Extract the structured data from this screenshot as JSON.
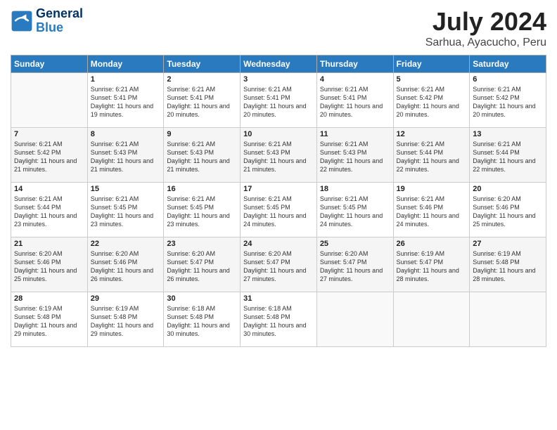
{
  "header": {
    "logo_line1": "General",
    "logo_line2": "Blue",
    "month_title": "July 2024",
    "location": "Sarhua, Ayacucho, Peru"
  },
  "days_of_week": [
    "Sunday",
    "Monday",
    "Tuesday",
    "Wednesday",
    "Thursday",
    "Friday",
    "Saturday"
  ],
  "weeks": [
    [
      {
        "day": "",
        "sunrise": "",
        "sunset": "",
        "daylight": ""
      },
      {
        "day": "1",
        "sunrise": "6:21 AM",
        "sunset": "5:41 PM",
        "daylight": "11 hours and 19 minutes."
      },
      {
        "day": "2",
        "sunrise": "6:21 AM",
        "sunset": "5:41 PM",
        "daylight": "11 hours and 20 minutes."
      },
      {
        "day": "3",
        "sunrise": "6:21 AM",
        "sunset": "5:41 PM",
        "daylight": "11 hours and 20 minutes."
      },
      {
        "day": "4",
        "sunrise": "6:21 AM",
        "sunset": "5:41 PM",
        "daylight": "11 hours and 20 minutes."
      },
      {
        "day": "5",
        "sunrise": "6:21 AM",
        "sunset": "5:42 PM",
        "daylight": "11 hours and 20 minutes."
      },
      {
        "day": "6",
        "sunrise": "6:21 AM",
        "sunset": "5:42 PM",
        "daylight": "11 hours and 20 minutes."
      }
    ],
    [
      {
        "day": "7",
        "sunrise": "6:21 AM",
        "sunset": "5:42 PM",
        "daylight": "11 hours and 21 minutes."
      },
      {
        "day": "8",
        "sunrise": "6:21 AM",
        "sunset": "5:43 PM",
        "daylight": "11 hours and 21 minutes."
      },
      {
        "day": "9",
        "sunrise": "6:21 AM",
        "sunset": "5:43 PM",
        "daylight": "11 hours and 21 minutes."
      },
      {
        "day": "10",
        "sunrise": "6:21 AM",
        "sunset": "5:43 PM",
        "daylight": "11 hours and 21 minutes."
      },
      {
        "day": "11",
        "sunrise": "6:21 AM",
        "sunset": "5:43 PM",
        "daylight": "11 hours and 22 minutes."
      },
      {
        "day": "12",
        "sunrise": "6:21 AM",
        "sunset": "5:44 PM",
        "daylight": "11 hours and 22 minutes."
      },
      {
        "day": "13",
        "sunrise": "6:21 AM",
        "sunset": "5:44 PM",
        "daylight": "11 hours and 22 minutes."
      }
    ],
    [
      {
        "day": "14",
        "sunrise": "6:21 AM",
        "sunset": "5:44 PM",
        "daylight": "11 hours and 23 minutes."
      },
      {
        "day": "15",
        "sunrise": "6:21 AM",
        "sunset": "5:45 PM",
        "daylight": "11 hours and 23 minutes."
      },
      {
        "day": "16",
        "sunrise": "6:21 AM",
        "sunset": "5:45 PM",
        "daylight": "11 hours and 23 minutes."
      },
      {
        "day": "17",
        "sunrise": "6:21 AM",
        "sunset": "5:45 PM",
        "daylight": "11 hours and 24 minutes."
      },
      {
        "day": "18",
        "sunrise": "6:21 AM",
        "sunset": "5:45 PM",
        "daylight": "11 hours and 24 minutes."
      },
      {
        "day": "19",
        "sunrise": "6:21 AM",
        "sunset": "5:46 PM",
        "daylight": "11 hours and 24 minutes."
      },
      {
        "day": "20",
        "sunrise": "6:20 AM",
        "sunset": "5:46 PM",
        "daylight": "11 hours and 25 minutes."
      }
    ],
    [
      {
        "day": "21",
        "sunrise": "6:20 AM",
        "sunset": "5:46 PM",
        "daylight": "11 hours and 25 minutes."
      },
      {
        "day": "22",
        "sunrise": "6:20 AM",
        "sunset": "5:46 PM",
        "daylight": "11 hours and 26 minutes."
      },
      {
        "day": "23",
        "sunrise": "6:20 AM",
        "sunset": "5:47 PM",
        "daylight": "11 hours and 26 minutes."
      },
      {
        "day": "24",
        "sunrise": "6:20 AM",
        "sunset": "5:47 PM",
        "daylight": "11 hours and 27 minutes."
      },
      {
        "day": "25",
        "sunrise": "6:20 AM",
        "sunset": "5:47 PM",
        "daylight": "11 hours and 27 minutes."
      },
      {
        "day": "26",
        "sunrise": "6:19 AM",
        "sunset": "5:47 PM",
        "daylight": "11 hours and 28 minutes."
      },
      {
        "day": "27",
        "sunrise": "6:19 AM",
        "sunset": "5:48 PM",
        "daylight": "11 hours and 28 minutes."
      }
    ],
    [
      {
        "day": "28",
        "sunrise": "6:19 AM",
        "sunset": "5:48 PM",
        "daylight": "11 hours and 29 minutes."
      },
      {
        "day": "29",
        "sunrise": "6:19 AM",
        "sunset": "5:48 PM",
        "daylight": "11 hours and 29 minutes."
      },
      {
        "day": "30",
        "sunrise": "6:18 AM",
        "sunset": "5:48 PM",
        "daylight": "11 hours and 30 minutes."
      },
      {
        "day": "31",
        "sunrise": "6:18 AM",
        "sunset": "5:48 PM",
        "daylight": "11 hours and 30 minutes."
      },
      {
        "day": "",
        "sunrise": "",
        "sunset": "",
        "daylight": ""
      },
      {
        "day": "",
        "sunrise": "",
        "sunset": "",
        "daylight": ""
      },
      {
        "day": "",
        "sunrise": "",
        "sunset": "",
        "daylight": ""
      }
    ]
  ]
}
